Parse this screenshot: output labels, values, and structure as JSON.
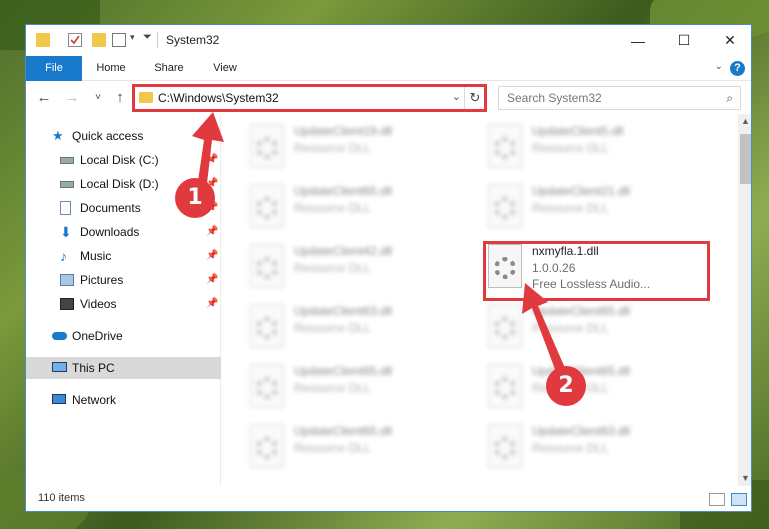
{
  "window": {
    "title": "System32",
    "minimize_icon": "—",
    "maximize_icon": "☐",
    "close_icon": "✕"
  },
  "ribbon": {
    "tabs": [
      "File",
      "Home",
      "Share",
      "View"
    ],
    "help_label": "?"
  },
  "nav": {
    "back_icon": "←",
    "forward_icon": "→",
    "recent_icon": "˅",
    "up_icon": "↑",
    "address": "C:\\Windows\\System32",
    "search_placeholder": "Search System32"
  },
  "sidebar": {
    "items": [
      {
        "label": "Quick access",
        "icon": "star-icon",
        "pinned": false
      },
      {
        "label": "Local Disk (C:)",
        "icon": "drive-icon",
        "pinned": true
      },
      {
        "label": "Local Disk (D:)",
        "icon": "drive-icon",
        "pinned": true
      },
      {
        "label": "Documents",
        "icon": "documents-icon",
        "pinned": true
      },
      {
        "label": "Downloads",
        "icon": "downloads-icon",
        "pinned": true
      },
      {
        "label": "Music",
        "icon": "music-icon",
        "pinned": true
      },
      {
        "label": "Pictures",
        "icon": "pictures-icon",
        "pinned": true
      },
      {
        "label": "Videos",
        "icon": "videos-icon",
        "pinned": true
      },
      {
        "label": "OneDrive",
        "icon": "cloud-icon",
        "pinned": false
      },
      {
        "label": "This PC",
        "icon": "computer-icon",
        "pinned": false,
        "selected": true
      },
      {
        "label": "Network",
        "icon": "network-icon",
        "pinned": false
      }
    ]
  },
  "files": {
    "left": [
      {
        "name": "UpdateClient19.dll",
        "type": "Resource DLL"
      },
      {
        "name": "UpdateClient65.dll",
        "type": "Resource DLL"
      },
      {
        "name": "UpdateClient42.dll",
        "type": "Resource DLL"
      },
      {
        "name": "UpdateClient63.dll",
        "type": "Resource DLL"
      },
      {
        "name": "UpdateClient65.dll",
        "type": "Resource DLL"
      },
      {
        "name": "UpdateClient65.dll",
        "type": "Resource DLL"
      }
    ],
    "right": [
      {
        "name": "UpdateClient5.dll",
        "type": "Resource DLL"
      },
      {
        "name": "UpdateClient21.dll",
        "type": "Resource DLL"
      },
      {
        "name": "nxmyfla.1.dll",
        "type": "1.0.0.26",
        "description": "Free Lossless Audio..."
      },
      {
        "name": "UpdateClient65.dll",
        "type": "Resource DLL"
      },
      {
        "name": "UpdateClient65.dll",
        "type": "Resource DLL"
      },
      {
        "name": "UpdateClient63.dll",
        "type": "Resource DLL"
      }
    ]
  },
  "status": {
    "item_count": "110 items"
  },
  "annotations": {
    "marker1": "1",
    "marker2": "2"
  },
  "colors": {
    "accent": "#1979ca",
    "highlight": "#e0393e"
  }
}
